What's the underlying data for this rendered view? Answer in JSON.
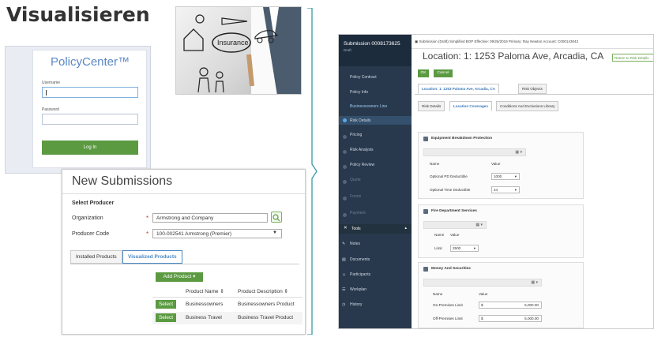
{
  "page_title": "Visualisieren",
  "photo": {
    "caption": "Insurance"
  },
  "login": {
    "logo": "PolicyCenter™",
    "username_label": "Username",
    "password_label": "Password",
    "button": "Log In"
  },
  "new_submission": {
    "title": "New Submissions",
    "section": "Select Producer",
    "org_label": "Organization",
    "org_value": "Armstrong and Company",
    "producer_label": "Producer Code",
    "producer_value": "100-002541 Armstrong (Premier)",
    "tabs": [
      "Installed Products",
      "Visualized Products"
    ],
    "add_product": "Add Product",
    "columns": [
      "Product Name ⇕",
      "Product Description ⇕"
    ],
    "rows": [
      {
        "action": "Select",
        "name": "Businessowners",
        "desc": "Businessowners Product"
      },
      {
        "action": "Select",
        "name": "Business Travel",
        "desc": "Business Travel Product"
      }
    ]
  },
  "guidewire": {
    "submission": "Submission 0008173625",
    "status": "Draft",
    "nav": [
      "Policy Contract",
      "Policy Info",
      "Businessowners Line",
      "Risk Details",
      "Pricing",
      "Risk Analysis",
      "Policy Review",
      "Quote",
      "Forms",
      "Payment"
    ],
    "tools": "Tools",
    "tool_items": [
      "Notes",
      "Documents",
      "Participants",
      "Workplan",
      "History"
    ],
    "topbar": "Submission (Draft)    Simplified BOP    Effective: 09/26/2019    Primary: Ray Newton    Account: C000143043",
    "location_title": "Location: 1: 1253 Paloma Ave, Arcadia, CA",
    "return_btn": "Return to Risk Details",
    "ok": "OK",
    "cancel": "Cancel",
    "tabs1": [
      "Location: 1: 1253 Paloma Ave, Arcadia, CA",
      "Risk Objects"
    ],
    "tabs2": [
      "Risk Details",
      "Location Coverages",
      "Conditions And Exclusions Library"
    ],
    "sections": [
      {
        "title": "Equipment Breakdown Protection",
        "cols": [
          "Name",
          "Value"
        ],
        "rows": [
          {
            "name": "Optional PD Deductible",
            "value": "1000"
          },
          {
            "name": "Optional Time Deductible",
            "value": "24"
          }
        ]
      },
      {
        "title": "Fire Department Services",
        "cols": [
          "Name",
          "Value"
        ],
        "rows": [
          {
            "name": "Limit",
            "value": "2500"
          }
        ]
      },
      {
        "title": "Money And Securities",
        "cols": [
          "Name",
          "Value"
        ],
        "rows": [
          {
            "name": "On-Premises Limit",
            "prefix": "$",
            "value": "5,000.00"
          },
          {
            "name": "Off-Premises Limit",
            "prefix": "$",
            "value": "5,000.00"
          }
        ]
      }
    ]
  }
}
